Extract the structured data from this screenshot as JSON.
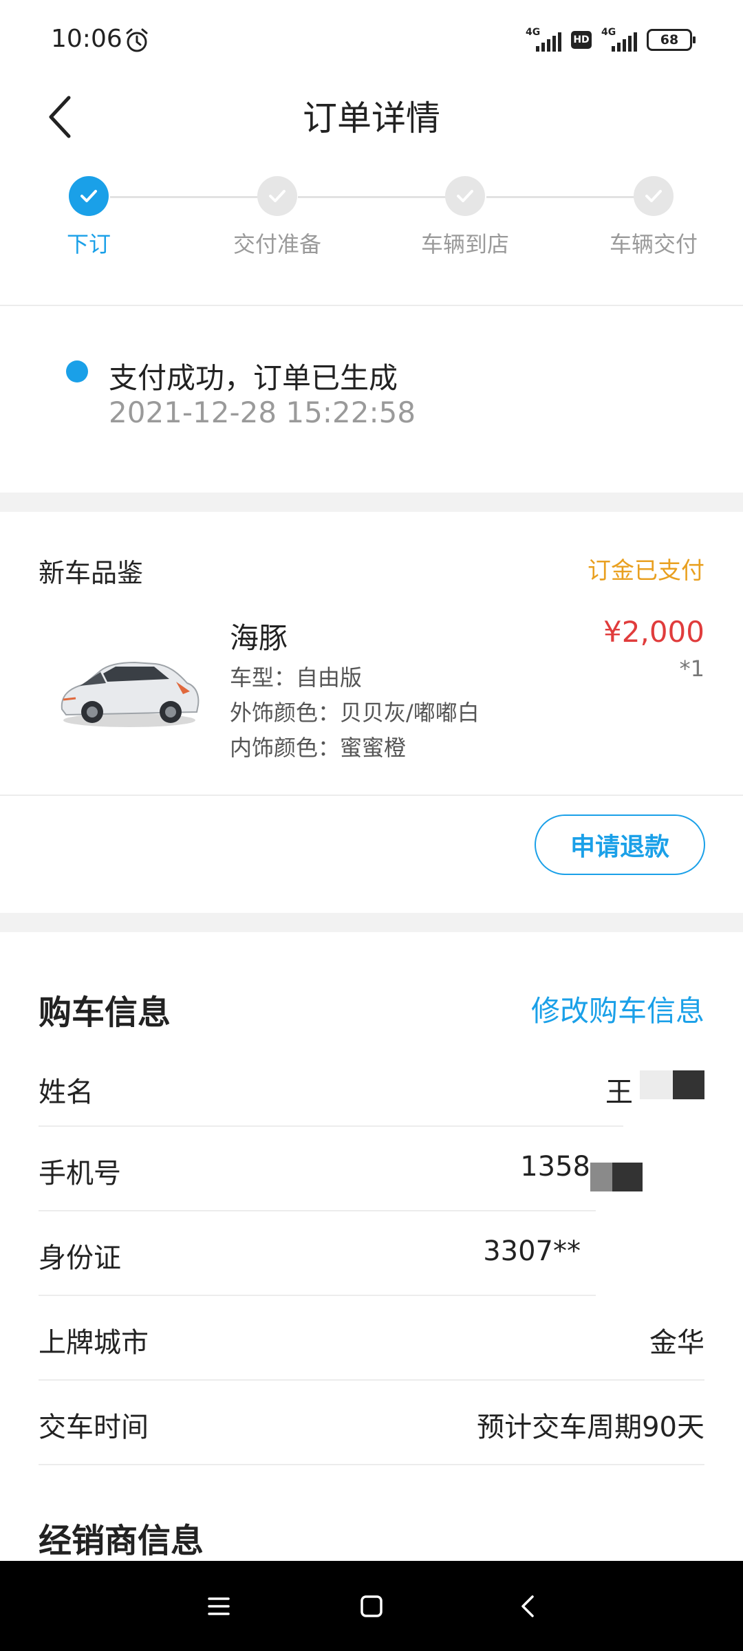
{
  "status_bar": {
    "time": "10:06",
    "signal_label_1": "4G",
    "hd_label": "HD",
    "signal_label_2": "4G",
    "battery": "68"
  },
  "nav": {
    "title": "订单详情"
  },
  "steps": [
    {
      "label": "下订",
      "state": "completed-current"
    },
    {
      "label": "交付准备",
      "state": "done-gray"
    },
    {
      "label": "车辆到店",
      "state": "done-gray"
    },
    {
      "label": "车辆交付",
      "state": "done-gray"
    }
  ],
  "order_status": {
    "text": "支付成功，订单已生成",
    "time": "2021-12-28 15:22:58"
  },
  "product": {
    "section_label": "新车品鉴",
    "status": "订金已支付",
    "name": "海豚",
    "model": "车型：自由版",
    "exterior": "外饰颜色：贝贝灰/嘟嘟白",
    "interior": "内饰颜色：蜜蜜橙",
    "price": "¥2,000",
    "qty": "*1"
  },
  "actions": {
    "refund": "申请退款"
  },
  "purchase_info": {
    "title": "购车信息",
    "edit": "修改购车信息",
    "rows": [
      {
        "label": "姓名",
        "value": "王"
      },
      {
        "label": "手机号",
        "value": "1358"
      },
      {
        "label": "身份证",
        "value": "3307**"
      },
      {
        "label": "上牌城市",
        "value": "金华"
      },
      {
        "label": "交车时间",
        "value": "预计交车周期90天"
      }
    ]
  },
  "dealer_info": {
    "title": "经销商信息"
  },
  "colors": {
    "accent": "#1aa0e8",
    "price": "#e03c3c",
    "paid": "#e9a020"
  }
}
